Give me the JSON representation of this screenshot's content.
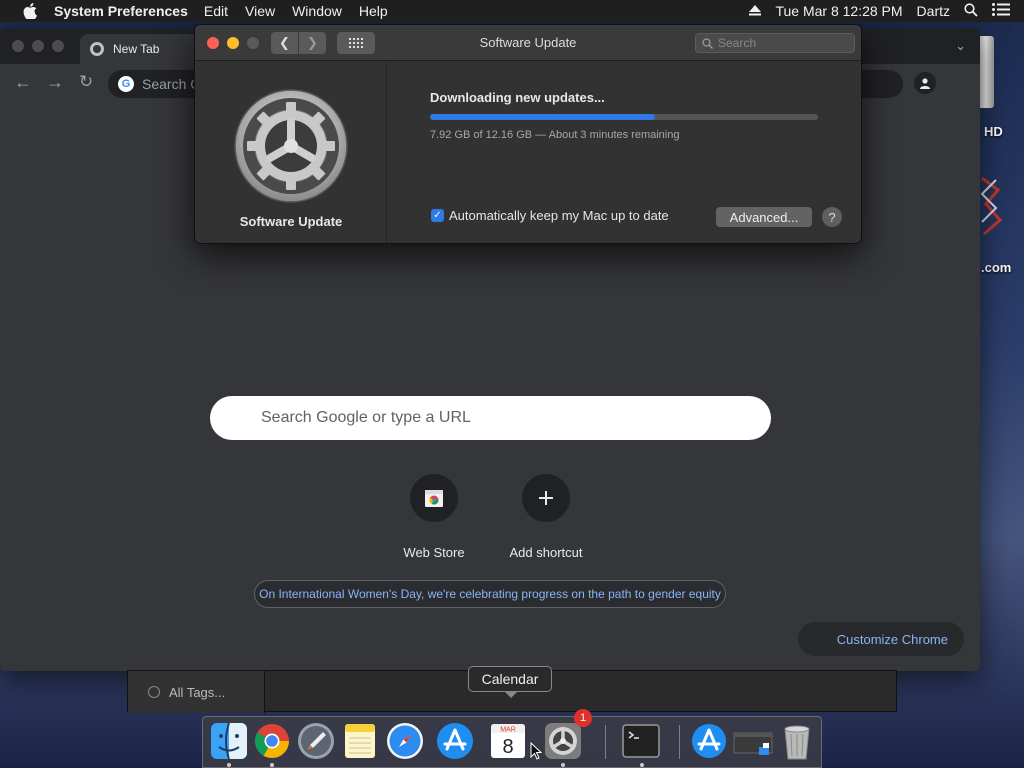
{
  "menubar": {
    "app_name": "System Preferences",
    "items": [
      "Edit",
      "View",
      "Window",
      "Help"
    ],
    "datetime": "Tue Mar 8  12:28 PM",
    "user": "Dartz"
  },
  "desktop": {
    "hd_label": "HD",
    "com_label": ".com"
  },
  "chrome": {
    "tab_title": "New Tab",
    "omnibox_placeholder": "Search G",
    "search_placeholder": "Search Google or type a URL",
    "shortcuts": [
      {
        "label": "Web Store"
      },
      {
        "label": "Add shortcut"
      }
    ],
    "promo_text": "On International Women's Day, we're celebrating progress on the path to gender equity",
    "customize_label": "Customize Chrome"
  },
  "finder": {
    "sidebar_item": "All Tags..."
  },
  "software_update": {
    "window_title": "Software Update",
    "search_placeholder": "Search",
    "pane_name": "Software Update",
    "status": "Downloading new updates...",
    "progress_fraction": 0.58,
    "detail": "7.92 GB of 12.16 GB — About 3 minutes remaining",
    "auto_update_label": "Automatically keep my Mac up to date",
    "auto_update_checked": true,
    "advanced_label": "Advanced...",
    "help_label": "?"
  },
  "dock": {
    "tooltip": "Calendar",
    "calendar_month": "MAR",
    "calendar_day": "8",
    "badge_count": "1",
    "apps": [
      "finder-icon",
      "chrome-icon",
      "launchpad-icon",
      "notes-icon",
      "safari-icon",
      "app-store-icon",
      "calendar-icon",
      "system-preferences-icon",
      "terminal-icon",
      "app-store-icon",
      "screen-icon",
      "trash-icon"
    ]
  },
  "colors": {
    "accent": "#2f7ae5",
    "link": "#8ab4f8",
    "badge": "#e0302b"
  }
}
